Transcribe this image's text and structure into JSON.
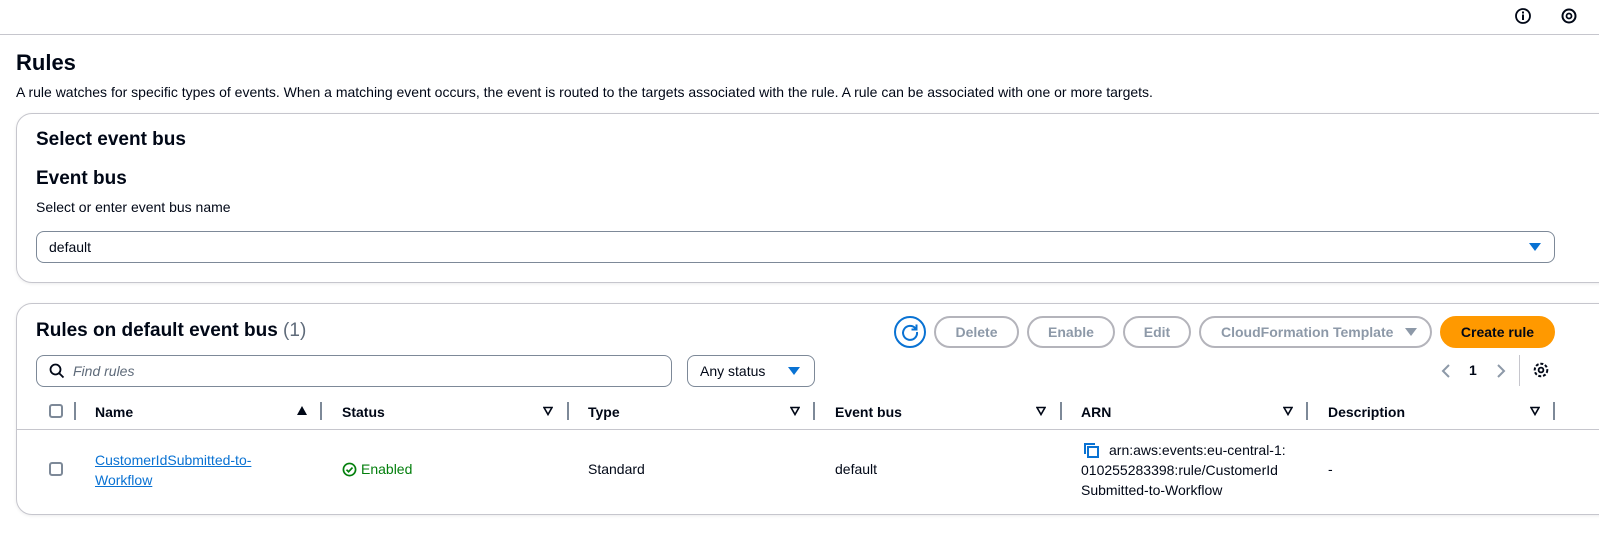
{
  "header": {
    "info_icon": "info-icon",
    "settings_icon": "gear-icon"
  },
  "page": {
    "title": "Rules",
    "description": "A rule watches for specific types of events. When a matching event occurs, the event is routed to the targets associated with the rule. A rule can be associated with one or more targets."
  },
  "event_bus_panel": {
    "heading": "Select event bus",
    "field_label": "Event bus",
    "field_description": "Select or enter event bus name",
    "selected_value": "default"
  },
  "rules_panel": {
    "heading": "Rules on default event bus",
    "count": "(1)",
    "buttons": {
      "delete": "Delete",
      "enable": "Enable",
      "edit": "Edit",
      "cloudformation": "CloudFormation Template",
      "create": "Create rule"
    },
    "search_placeholder": "Find rules",
    "status_filter": "Any status",
    "pagination": {
      "current_page": "1"
    },
    "columns": [
      "Name",
      "Status",
      "Type",
      "Event bus",
      "ARN",
      "Description"
    ],
    "rows": [
      {
        "name_line1": "CustomerIdSubmitted-to-",
        "name_line2": "Workflow",
        "status": "Enabled",
        "type": "Standard",
        "event_bus": "default",
        "arn_line1": "arn:aws:events:eu-central-1:",
        "arn_line2": "010255283398:rule/CustomerId",
        "arn_line3": "Submitted-to-Workflow",
        "description": "-"
      }
    ]
  },
  "colors": {
    "primary": "#ff9900",
    "link": "#0972d3",
    "success": "#037f0c",
    "border": "#c6c6cd"
  }
}
